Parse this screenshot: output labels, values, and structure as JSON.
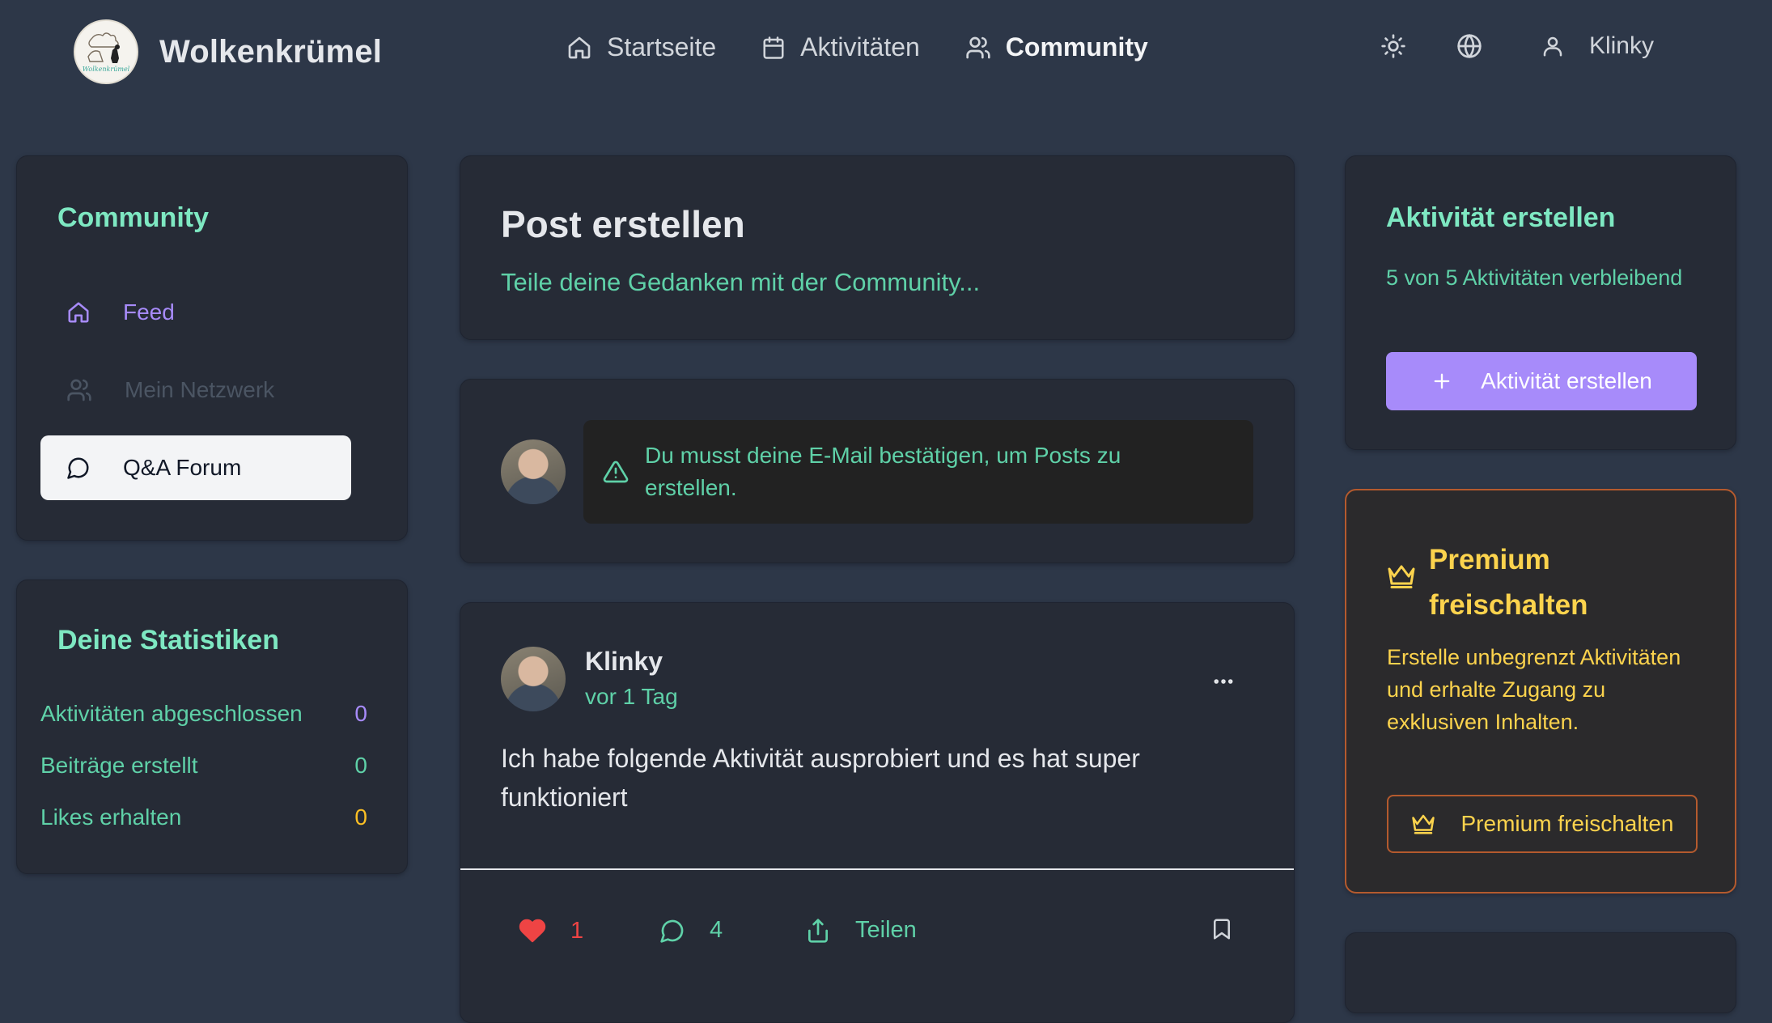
{
  "header": {
    "brand_name": "Wolkenkrümel",
    "logo_text": "Wolkenkrümel",
    "nav": [
      {
        "label": "Startseite",
        "icon": "home-icon"
      },
      {
        "label": "Aktivitäten",
        "icon": "calendar-icon"
      },
      {
        "label": "Community",
        "icon": "users-icon",
        "active": true
      }
    ],
    "user_name": "Klinky"
  },
  "sidebar": {
    "title": "Community",
    "items": [
      {
        "label": "Feed",
        "icon": "home-icon",
        "state": "active"
      },
      {
        "label": "Mein Netzwerk",
        "icon": "users-icon",
        "state": "disabled"
      },
      {
        "label": "Q&A Forum",
        "icon": "message-circle-icon",
        "state": "selected"
      }
    ]
  },
  "stats": {
    "title": "Deine Statistiken",
    "rows": [
      {
        "label": "Aktivitäten abgeschlossen",
        "value": "0",
        "color": "#a78bfa"
      },
      {
        "label": "Beiträge erstellt",
        "value": "0",
        "color": "#5fd1a8"
      },
      {
        "label": "Likes erhalten",
        "value": "0",
        "color": "#fbbf24"
      }
    ]
  },
  "create_post": {
    "title": "Post erstellen",
    "placeholder": "Teile deine Gedanken mit der Community..."
  },
  "verify": {
    "message": "Du musst deine E-Mail bestätigen, um Posts zu erstellen."
  },
  "post": {
    "author": "Klinky",
    "time": "vor 1 Tag",
    "body": "Ich habe folgende Aktivität ausprobiert und es hat super funktioniert",
    "likes": "1",
    "comments": "4",
    "share_label": "Teilen"
  },
  "activity": {
    "title": "Aktivität erstellen",
    "remaining": "5 von 5 Aktivitäten verbleibend",
    "button_label": "Aktivität erstellen"
  },
  "premium": {
    "title": "Premium freischalten",
    "description": "Erstelle unbegrenzt Aktivitäten und erhalte Zugang zu exklusiven Inhalten.",
    "button_label": "Premium freischalten"
  },
  "colors": {
    "background": "#2d3748",
    "card": "#262b36",
    "accent_green": "#7ee8c2",
    "accent_purple": "#a78bfa",
    "premium_gold": "#fcd34d",
    "like_red": "#ef4444"
  }
}
